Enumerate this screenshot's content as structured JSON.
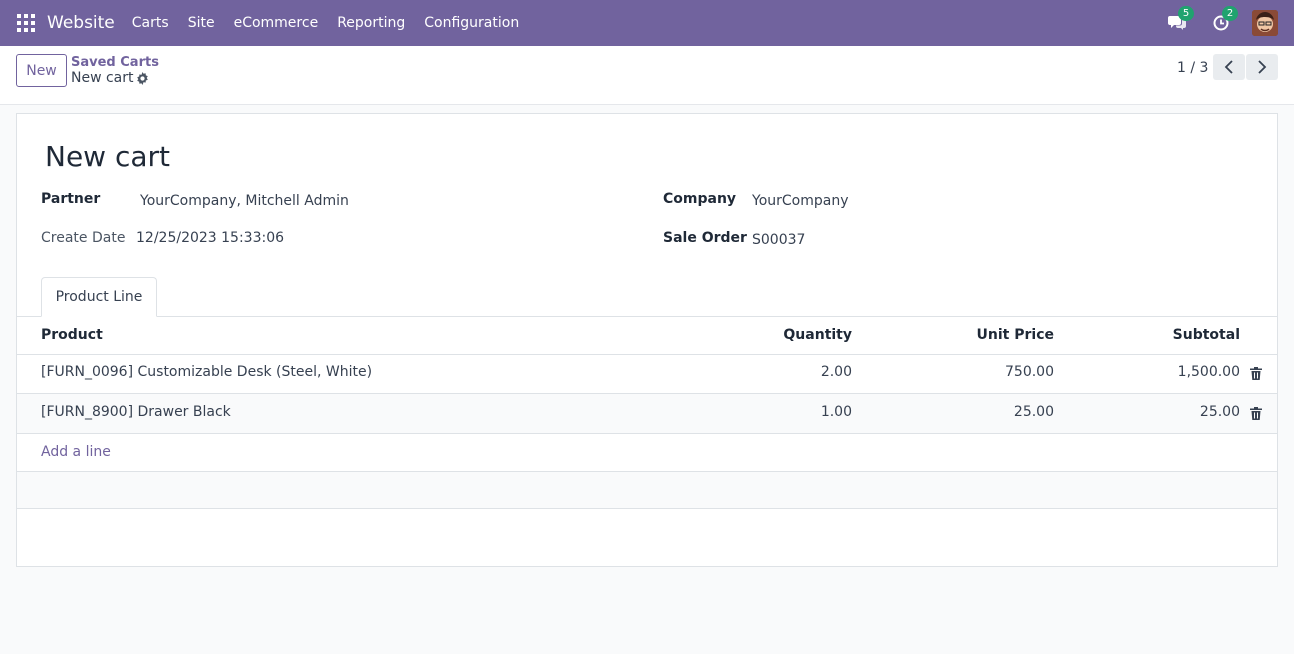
{
  "navbar": {
    "brand": "Website",
    "menu": [
      "Carts",
      "Site",
      "eCommerce",
      "Reporting",
      "Configuration"
    ],
    "messages_count": "5",
    "activities_count": "2",
    "bg_color": "#71639e"
  },
  "control": {
    "new_label": "New",
    "breadcrumb_parent": "Saved Carts",
    "breadcrumb_current": "New cart",
    "pager": "1 / 3"
  },
  "form": {
    "title": "New cart",
    "partner_label": "Partner",
    "partner_value": "YourCompany, Mitchell Admin",
    "create_date_label": "Create Date",
    "create_date_value": "12/25/2023 15:33:06",
    "company_label": "Company",
    "company_value": "YourCompany",
    "sale_order_label": "Sale Order",
    "sale_order_value": "S00037"
  },
  "tabs": [
    "Product Line"
  ],
  "table": {
    "headers": [
      "Product",
      "Quantity",
      "Unit Price",
      "Subtotal"
    ],
    "rows": [
      {
        "product": "[FURN_0096] Customizable Desk (Steel, White)",
        "quantity": "2.00",
        "unit_price": "750.00",
        "subtotal": "1,500.00"
      },
      {
        "product": "[FURN_8900] Drawer Black",
        "quantity": "1.00",
        "unit_price": "25.00",
        "subtotal": "25.00"
      }
    ],
    "add_line": "Add a line"
  }
}
